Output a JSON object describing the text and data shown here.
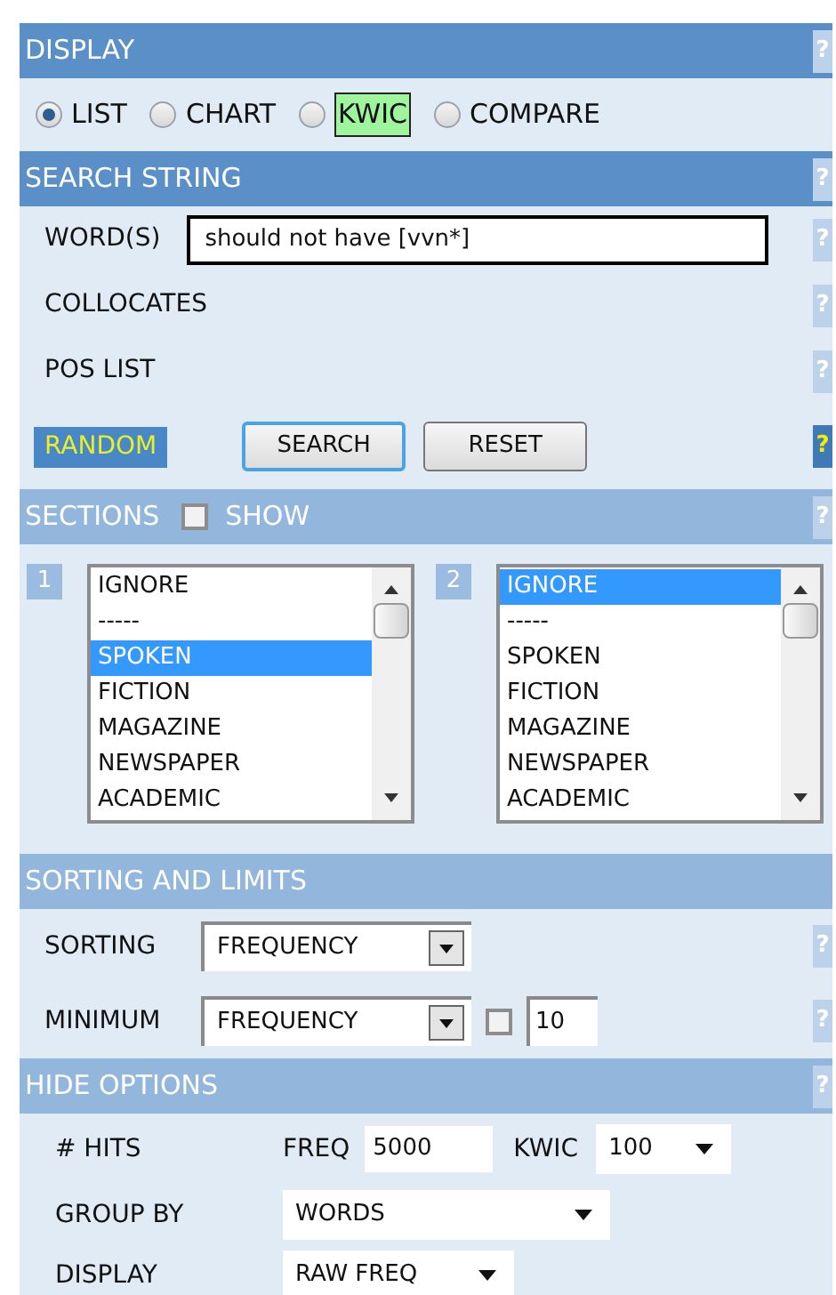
{
  "display": {
    "title": "DISPLAY",
    "help": "?",
    "options": [
      {
        "label": "LIST",
        "selected": true,
        "highlighted": false
      },
      {
        "label": "CHART",
        "selected": false,
        "highlighted": false
      },
      {
        "label": "KWIC",
        "selected": false,
        "highlighted": true
      },
      {
        "label": "COMPARE",
        "selected": false,
        "highlighted": false
      }
    ]
  },
  "search": {
    "title": "SEARCH STRING",
    "help": "?",
    "rows": [
      {
        "label": "WORD(S)",
        "kind": "text",
        "value": "should not have [vvn*]",
        "help": "?"
      },
      {
        "label": "COLLOCATES",
        "kind": "plain",
        "help": "?"
      },
      {
        "label": "POS LIST",
        "kind": "plain",
        "help": "?"
      }
    ],
    "random": "RANDOM",
    "buttons": [
      {
        "label": "SEARCH",
        "focused": true
      },
      {
        "label": "RESET",
        "focused": false
      }
    ],
    "random_help": "?"
  },
  "sections": {
    "title": "SECTIONS",
    "show_label": "SHOW",
    "show_checked": false,
    "help": "?",
    "lists": [
      {
        "number": "1",
        "items": [
          {
            "label": "IGNORE",
            "selected": false
          },
          {
            "label": "-----",
            "selected": false
          },
          {
            "label": "SPOKEN",
            "selected": true
          },
          {
            "label": "FICTION",
            "selected": false
          },
          {
            "label": "MAGAZINE",
            "selected": false
          },
          {
            "label": "NEWSPAPER",
            "selected": false
          },
          {
            "label": "ACADEMIC",
            "selected": false
          }
        ]
      },
      {
        "number": "2",
        "items": [
          {
            "label": "IGNORE",
            "selected": true
          },
          {
            "label": "-----",
            "selected": false
          },
          {
            "label": "SPOKEN",
            "selected": false
          },
          {
            "label": "FICTION",
            "selected": false
          },
          {
            "label": "MAGAZINE",
            "selected": false
          },
          {
            "label": "NEWSPAPER",
            "selected": false
          },
          {
            "label": "ACADEMIC",
            "selected": false
          }
        ]
      }
    ]
  },
  "sorting": {
    "title": "SORTING AND LIMITS",
    "sorting": {
      "label": "SORTING",
      "value": "FREQUENCY",
      "help": "?"
    },
    "minimum": {
      "label": "MINIMUM",
      "value": "FREQUENCY",
      "checked": false,
      "number": "10",
      "help": "?"
    }
  },
  "hide": {
    "title": "HIDE OPTIONS",
    "help": "?",
    "hits": {
      "label": "# HITS",
      "freq_label": "FREQ",
      "freq_value": "5000",
      "kwic_label": "KWIC",
      "kwic_value": "100"
    },
    "group_by": {
      "label": "GROUP BY",
      "value": "WORDS"
    },
    "display": {
      "label": "DISPLAY",
      "value": "RAW FREQ"
    }
  }
}
